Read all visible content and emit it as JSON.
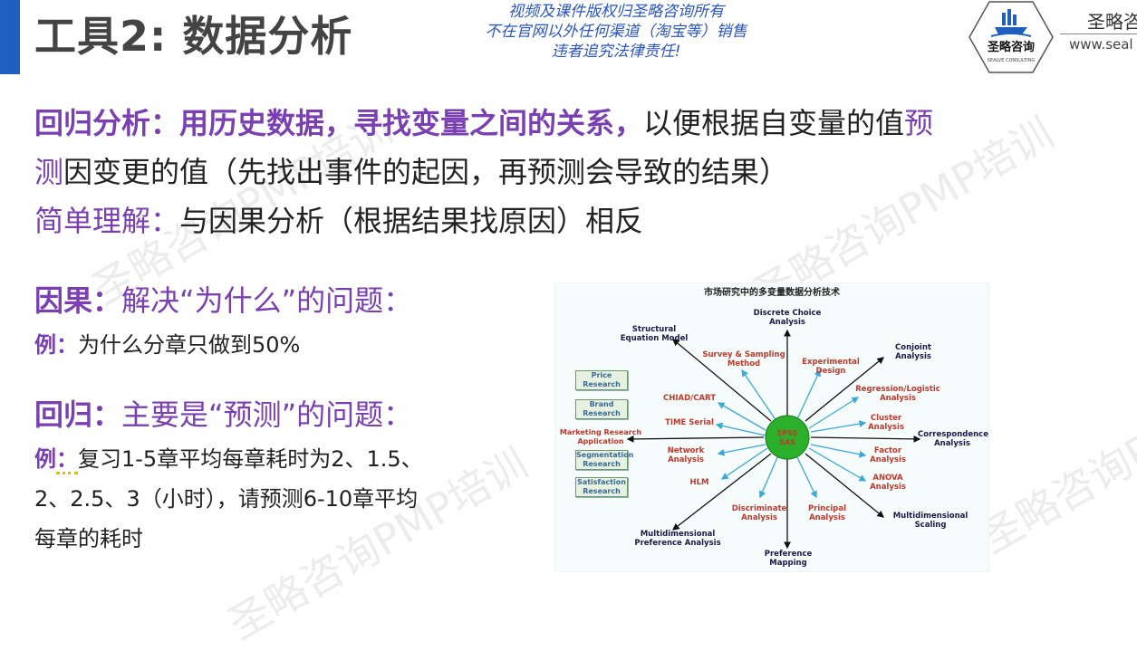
{
  "header": {
    "title": "工具2: 数据分析",
    "copyright_lines": [
      "视频及课件版权归圣略咨询所有",
      "不在官网以外任何渠道（淘宝等）销售",
      "违者追究法律责任!"
    ],
    "logo_text": "圣略咨询",
    "logo_sub": "SEALVE CONSULTING",
    "brand_name": "圣略咨",
    "brand_url": "www.seal"
  },
  "content": {
    "line1_purple": "回归分析：用历史数据，寻找变量之间的关系，",
    "line1_rest": "以便根据自变量的值",
    "line1_end": "预",
    "line2_start": "测",
    "line2_rest": "因变更的值（先找出事件的起因，再预测会导致的结果）",
    "line3_purple": "简单理解：",
    "line3_rest": "与因果分析（根据结果找原因）相反",
    "causal_title": "因果：",
    "causal_rest": "解决“为什么”的问题：",
    "causal_example_label": "例：",
    "causal_example": "为什么分章只做到50%",
    "regression_title": "回归：",
    "regression_rest": "主要是“预测”的问题：",
    "regression_example_label": "例",
    "regression_example_colon": "：",
    "regression_example_line1": "复习1-5章平均每章耗时为2、1.5、",
    "regression_example_line2": "2、2.5、3（小时），请预测6-10章平均",
    "regression_example_line3": "每章的耗时"
  },
  "watermark": "圣略咨询PMP培训",
  "diagram": {
    "title": "市场研究中的多变量数据分析技术",
    "center_line1": "SPSS",
    "center_line2": "SAS",
    "dark_labels": [
      "Discrete Choice Analysis",
      "Structural Equation Model",
      "Conjoint Analysis",
      "Correspondence Analysis",
      "Multidimensional Scaling",
      "Preference Mapping",
      "Multidimensional Preference Analysis"
    ],
    "red_labels": [
      "Survey & Sampling Method",
      "Experimental Design",
      "Regression/Logistic Analysis",
      "CHIAD/CART",
      "TIME Serial",
      "Cluster Analysis",
      "Network Analysis",
      "Factor Analysis",
      "HLM",
      "ANOVA Analysis",
      "Discriminate Analysis",
      "Principal Analysis"
    ],
    "side_boxes": [
      "Price Research",
      "Brand Research",
      "Marketing Research Application",
      "Segmentation Research",
      "Satisfaction Research"
    ]
  },
  "colors": {
    "accent": "#1f5fbf",
    "purple": "#7b3fb4",
    "center_green": "#2bb02b",
    "center_text": "#c0392b"
  }
}
